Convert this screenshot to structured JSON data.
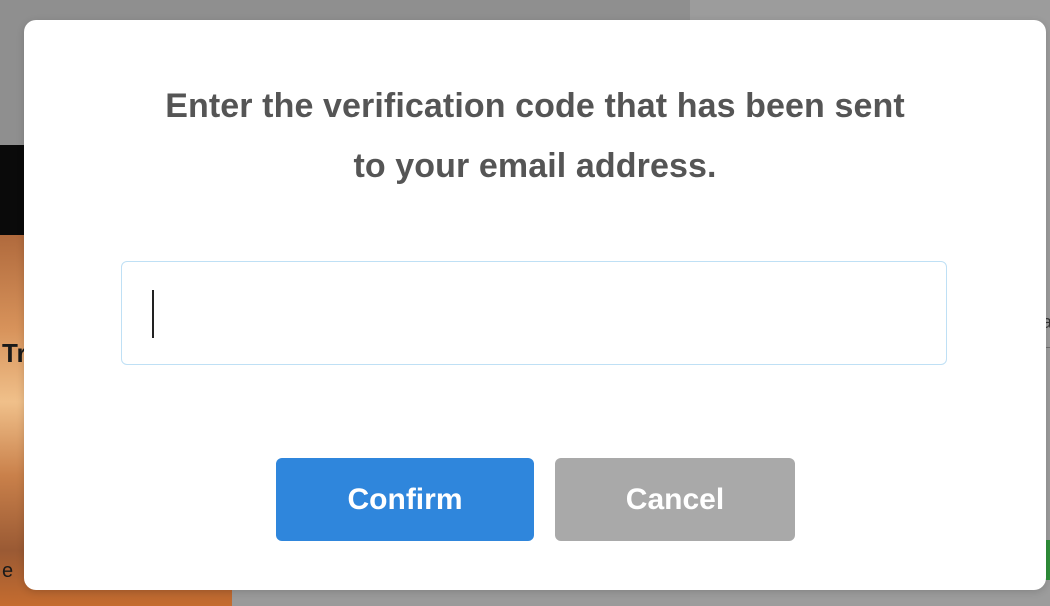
{
  "background": {
    "photo_text_top": "Tr",
    "photo_text_bottom": "e",
    "right_edge_char": "a"
  },
  "dialog": {
    "title_line1": "Enter the verification code that has been sent",
    "title_line2": "to your email address.",
    "code_input": {
      "value": "",
      "placeholder": ""
    },
    "confirm_label": "Confirm",
    "cancel_label": "Cancel"
  },
  "colors": {
    "confirm_bg": "#2f86dc",
    "cancel_bg": "#a9a9a9",
    "title_text": "#555555",
    "input_border": "#bfe0f5"
  }
}
